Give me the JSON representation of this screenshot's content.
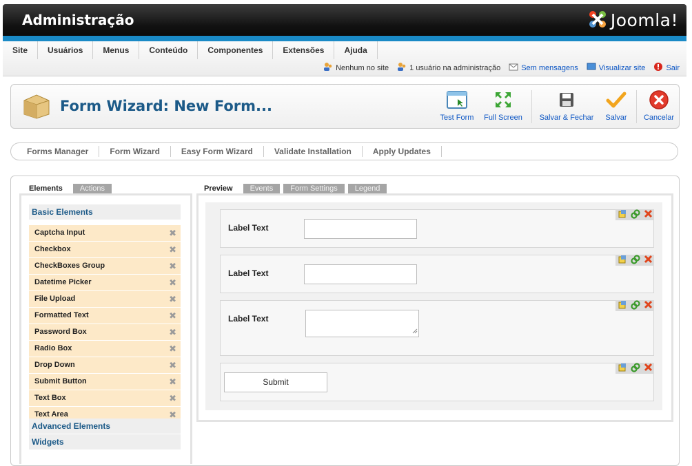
{
  "header": {
    "title": "Administração",
    "brand": "Joomla!"
  },
  "menu": [
    "Site",
    "Usuários",
    "Menus",
    "Conteúdo",
    "Componentes",
    "Extensões",
    "Ajuda"
  ],
  "status": {
    "visitors": "Nenhum no site",
    "admins": "1 usuário na administração",
    "messages": "Sem mensagens",
    "view_site": "Visualizar site",
    "logout": "Sair"
  },
  "toolbar": {
    "title": "Form Wizard: New Form...",
    "test_form": "Test Form",
    "full_screen": "Full Screen",
    "save_close": "Salvar & Fechar",
    "save": "Salvar",
    "cancel": "Cancelar"
  },
  "subnav": [
    "Forms Manager",
    "Form Wizard",
    "Easy Form Wizard",
    "Validate Installation",
    "Apply Updates"
  ],
  "left_tabs": [
    "Elements",
    "Actions"
  ],
  "sections": {
    "basic": "Basic Elements",
    "advanced": "Advanced Elements",
    "widgets": "Widgets"
  },
  "basic_elements": [
    "Captcha Input",
    "Checkbox",
    "CheckBoxes Group",
    "Datetime Picker",
    "File Upload",
    "Formatted Text",
    "Password Box",
    "Radio Box",
    "Drop Down",
    "Submit Button",
    "Text Box",
    "Text Area"
  ],
  "preview_tabs": [
    "Preview",
    "Events",
    "Form Settings",
    "Legend"
  ],
  "preview": {
    "fields": [
      {
        "label": "Label Text",
        "kind": "text"
      },
      {
        "label": "Label Text",
        "kind": "text"
      },
      {
        "label": "Label Text",
        "kind": "textarea"
      }
    ],
    "submit_label": "Submit"
  },
  "colors": {
    "header_blue": "#1a8ac6",
    "title_blue": "#1c5a88",
    "link_blue": "#0b55c4",
    "element_bg": "#fde9c8"
  }
}
